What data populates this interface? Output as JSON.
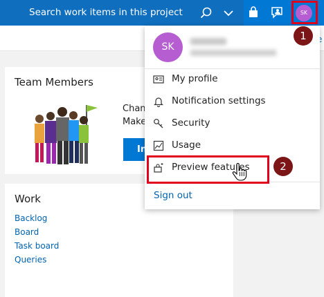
{
  "topbar": {
    "search_placeholder": "Search work items in this project",
    "avatar_initials": "SK"
  },
  "team_card": {
    "title": "Team Members",
    "promo_line_1": "Chang",
    "promo_line_2": "Make y",
    "invite_button": "Invite"
  },
  "work_card": {
    "title": "Work",
    "links": [
      "Backlog",
      "Board",
      "Task board",
      "Queries"
    ]
  },
  "profile_menu": {
    "avatar_initials": "SK",
    "items": [
      {
        "label": "My profile",
        "icon": "contact-card-icon"
      },
      {
        "label": "Notification settings",
        "icon": "bell-icon"
      },
      {
        "label": "Security",
        "icon": "key-icon"
      },
      {
        "label": "Usage",
        "icon": "usage-chart-icon"
      },
      {
        "label": "Preview features",
        "icon": "preview-sparkle-icon"
      }
    ],
    "sign_out": "Sign out"
  },
  "annotations": {
    "step_1": "1",
    "step_2": "2",
    "highlight_color": "#e0001b",
    "badge_color": "#7b1516"
  },
  "colors": {
    "brand_blue": "#0078d4",
    "avatar_purple": "#b65dd2",
    "link_blue": "#0063b1"
  }
}
